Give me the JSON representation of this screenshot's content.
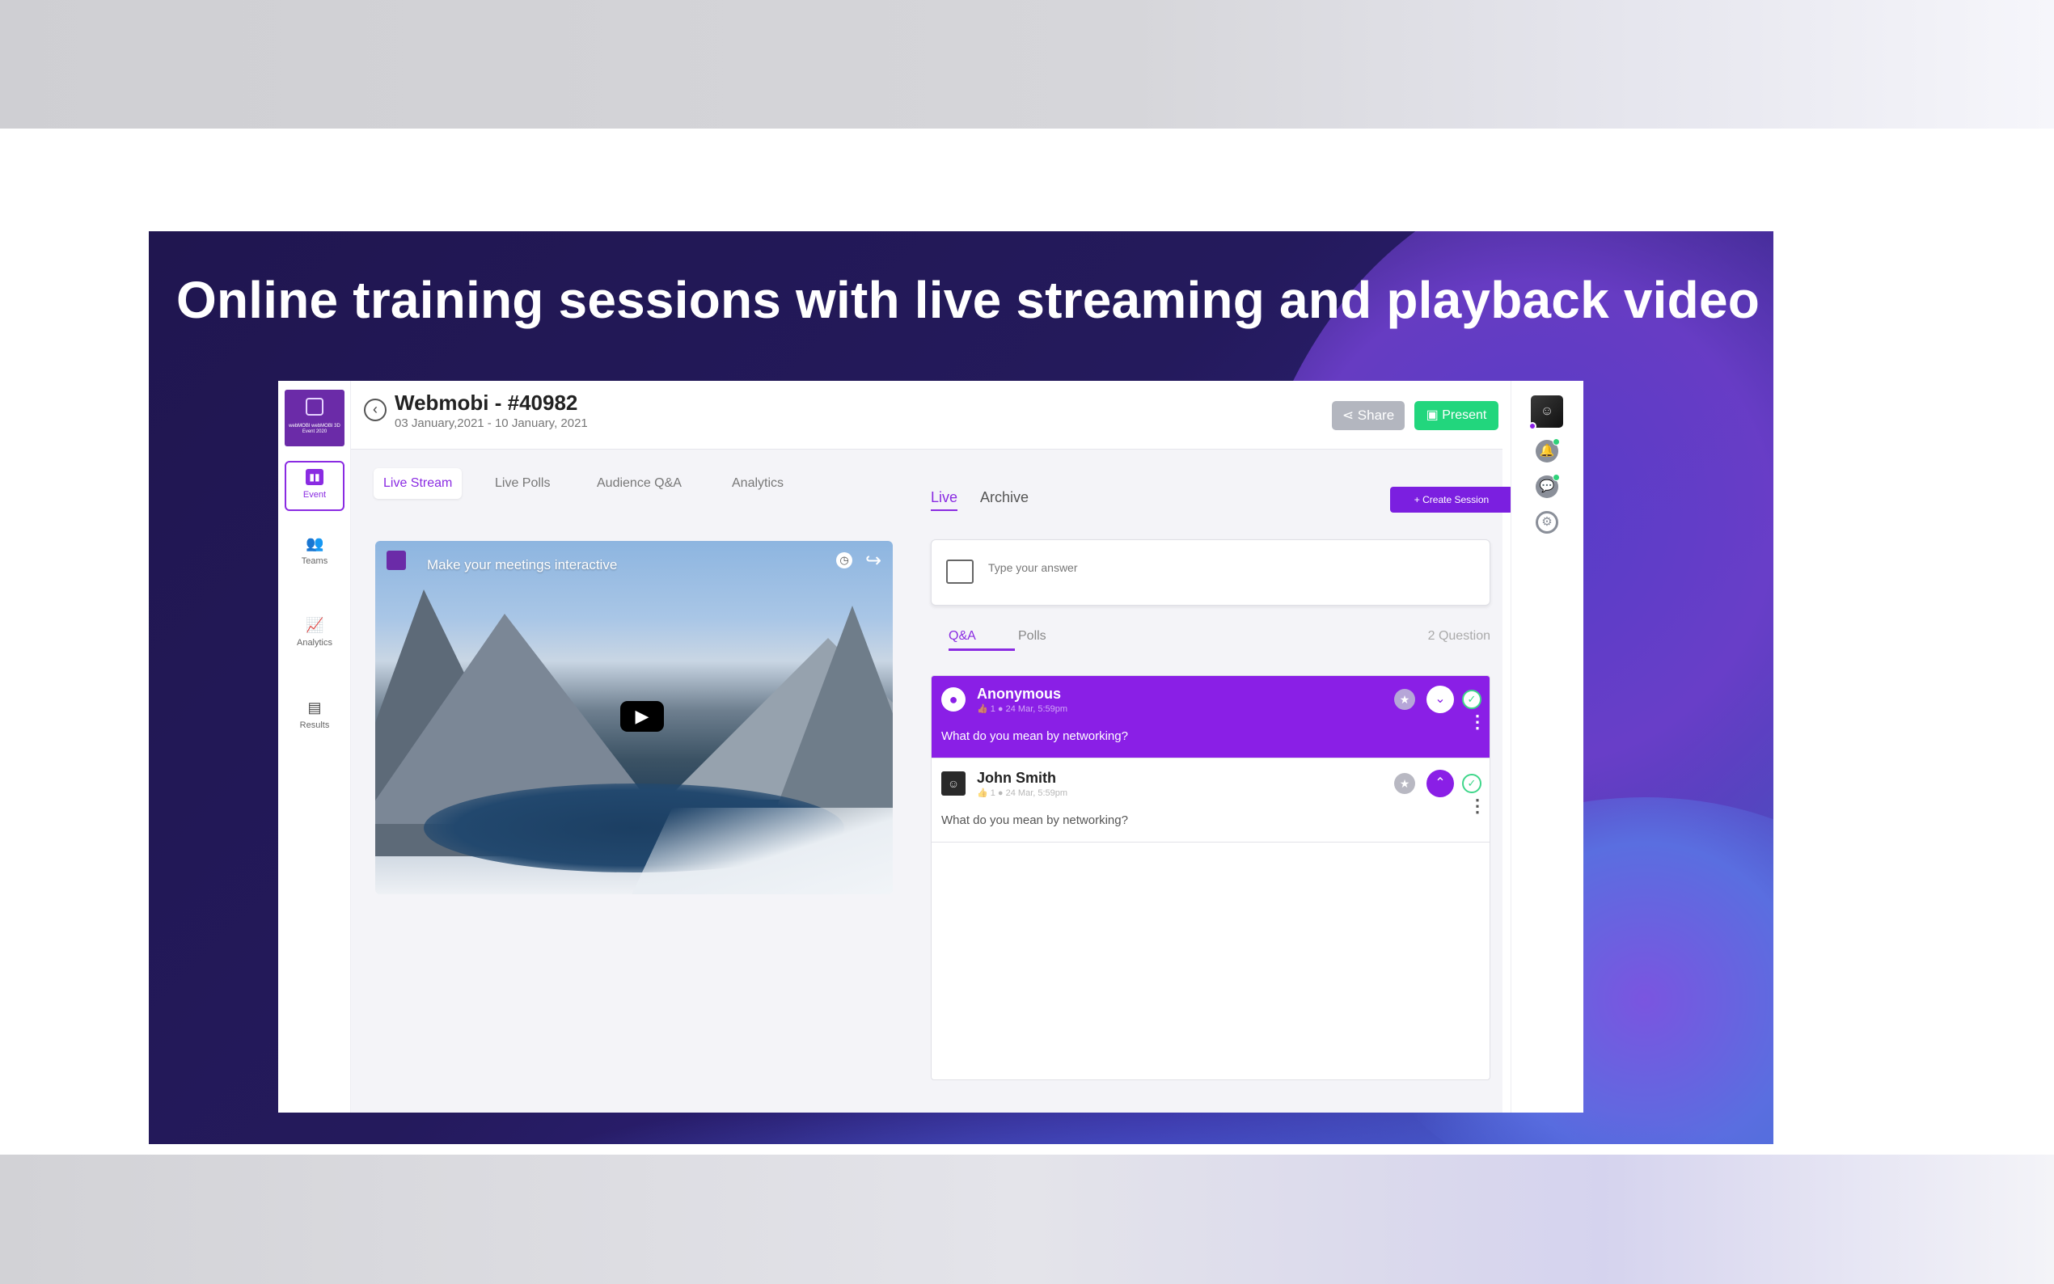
{
  "headline": "Online training sessions with live streaming and playback video",
  "sidebar": {
    "logo_text": "webMOBI webMOBI 3D Event 2020",
    "items": [
      {
        "label": "Event",
        "icon": "bar-chart-icon"
      },
      {
        "label": "Teams",
        "icon": "team-icon"
      },
      {
        "label": "Analytics",
        "icon": "analytics-icon"
      },
      {
        "label": "Results",
        "icon": "results-icon"
      }
    ]
  },
  "header": {
    "title": "Webmobi - #40982",
    "dates": "03 January,2021 - 10 January, 2021",
    "share_label": "Share",
    "present_label": "Present"
  },
  "tabs": [
    "Live Stream",
    "Live Polls",
    "Audience Q&A",
    "Analytics"
  ],
  "video": {
    "title": "Make your meetings interactive"
  },
  "session": {
    "tabs": [
      "Live",
      "Archive"
    ],
    "create_label": "+ Create Session",
    "answer_placeholder": "Type your answer"
  },
  "qa": {
    "tabs": [
      "Q&A",
      "Polls"
    ],
    "count": "2 Question",
    "questions": [
      {
        "name": "Anonymous",
        "meta": "👍 1  ● 24 Mar, 5:59pm",
        "text": "What do you mean by networking?"
      },
      {
        "name": "John Smith",
        "meta": "👍 1  ● 24 Mar, 5:59pm",
        "text": "What do you mean by networking?"
      }
    ]
  },
  "colors": {
    "accent": "#8a1fe6",
    "present": "#22d67d",
    "share": "#b3b6bf"
  }
}
